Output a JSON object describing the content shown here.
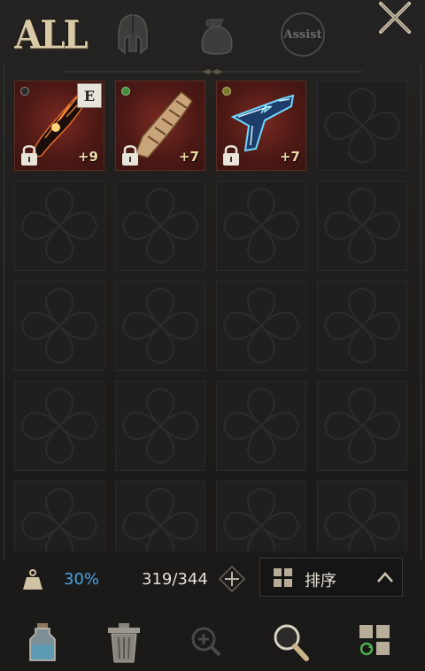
{
  "tabs": {
    "all_label": "ALL",
    "items": [
      "helmet-icon",
      "bag-icon",
      "assist-icon"
    ],
    "assist_label": "Assist"
  },
  "inventory": {
    "slots": [
      {
        "kind": "item",
        "weapon": "flame-gauntlet-icon",
        "grade": "empty",
        "equipped": true,
        "equip_badge": "E",
        "locked": true,
        "level": "+9"
      },
      {
        "kind": "item",
        "weapon": "bandaged-gauntlet-icon",
        "grade": "green",
        "equipped": false,
        "locked": true,
        "level": "+7"
      },
      {
        "kind": "item",
        "weapon": "lightning-pistol-icon",
        "grade": "olive",
        "equipped": false,
        "locked": true,
        "level": "+7"
      },
      {
        "kind": "empty"
      },
      {
        "kind": "empty"
      },
      {
        "kind": "empty"
      },
      {
        "kind": "empty"
      },
      {
        "kind": "empty"
      },
      {
        "kind": "empty"
      },
      {
        "kind": "empty"
      },
      {
        "kind": "empty"
      },
      {
        "kind": "empty"
      },
      {
        "kind": "empty"
      },
      {
        "kind": "empty"
      },
      {
        "kind": "empty"
      },
      {
        "kind": "empty"
      },
      {
        "kind": "empty"
      },
      {
        "kind": "empty"
      },
      {
        "kind": "empty"
      },
      {
        "kind": "empty"
      }
    ]
  },
  "status": {
    "weight_percent": "30%",
    "capacity": "319/344",
    "sort_label": "排序"
  },
  "toolbar": {
    "buttons": [
      "potion-icon",
      "trash-icon",
      "zoom-plus-icon",
      "search-icon",
      "auto-sort-icon"
    ]
  },
  "colors": {
    "accent_blue": "#4aa3e6",
    "item_bg": "#4e1915",
    "gold_text": "#f0d9a8"
  }
}
